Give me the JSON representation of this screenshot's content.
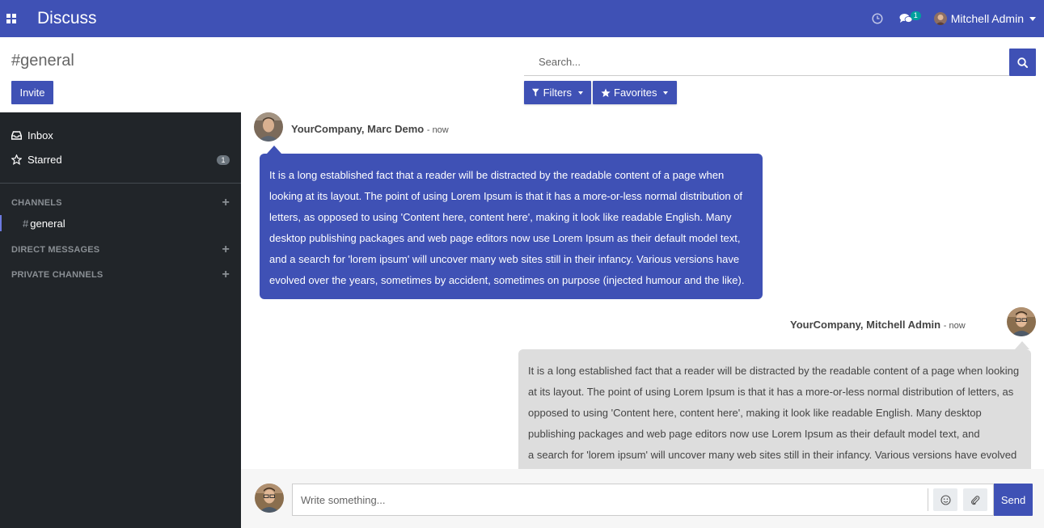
{
  "navbar": {
    "app_title": "Discuss",
    "chat_badge": "1",
    "user_name": "Mitchell Admin",
    "color": "#3f51b5"
  },
  "control_panel": {
    "title": "#general",
    "invite_label": "Invite",
    "search_placeholder": "Search...",
    "filters_label": "Filters",
    "favorites_label": "Favorites"
  },
  "sidebar": {
    "inbox_label": "Inbox",
    "starred_label": "Starred",
    "starred_count": "1",
    "channels_header": "CHANNELS",
    "channels": [
      {
        "name": "general"
      }
    ],
    "direct_messages_header": "DIRECT MESSAGES",
    "private_channels_header": "PRIVATE CHANNELS"
  },
  "thread": {
    "messages": [
      {
        "author": "YourCompany, Marc Demo",
        "date": "- now",
        "lines": [
          "It is a long established fact that a reader will be distracted by the readable content of a page when",
          "looking at its layout. The point of using Lorem Ipsum is that it has a more-or-less normal distribution of",
          "letters, as opposed to using 'Content here, content here', making it look like readable English. Many",
          "desktop publishing packages and web page editors now use Lorem Ipsum as their default model text,",
          "and a search for 'lorem ipsum' will uncover many web sites still in their infancy. Various versions have",
          "evolved over the years, sometimes by accident, sometimes on purpose (injected humour and the like)."
        ]
      },
      {
        "author": "YourCompany, Mitchell Admin",
        "date": "- now",
        "lines": [
          "It is a long established fact that a reader will be distracted by the readable content of a page when looking",
          "at its layout. The point of using Lorem Ipsum is that it has a more-or-less normal distribution of letters, as",
          "opposed to using 'Content here, content here', making it look like readable English. Many desktop",
          "publishing packages and web page editors now use Lorem Ipsum as their default model text, and",
          "a search for 'lorem ipsum' will uncover many web sites still in their infancy. Various versions have evolved"
        ]
      }
    ]
  },
  "composer": {
    "placeholder": "Write something...",
    "send_label": "Send"
  }
}
